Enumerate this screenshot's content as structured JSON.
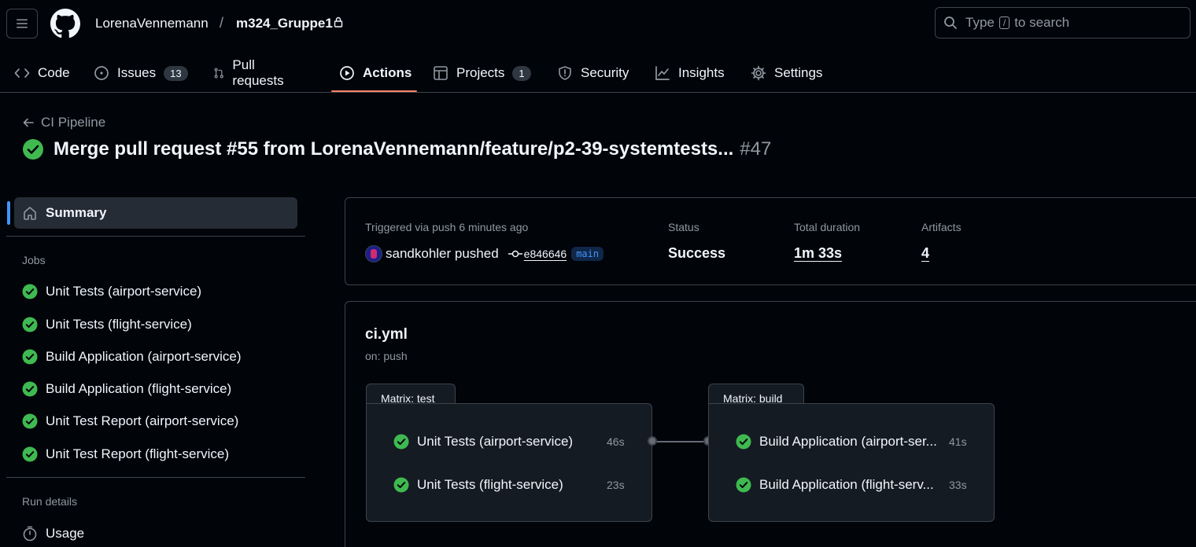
{
  "header": {
    "owner": "LorenaVennemann",
    "separator": "/",
    "repo": "m324_Gruppe1",
    "search": {
      "prefix": "Type",
      "key": "/",
      "suffix": "to search"
    }
  },
  "tabs": [
    {
      "label": "Code",
      "icon": "code-icon"
    },
    {
      "label": "Issues",
      "icon": "issue-icon",
      "count": "13"
    },
    {
      "label": "Pull requests",
      "icon": "pull-request-icon"
    },
    {
      "label": "Actions",
      "icon": "play-icon",
      "active": true
    },
    {
      "label": "Projects",
      "icon": "table-icon",
      "count": "1"
    },
    {
      "label": "Security",
      "icon": "shield-icon"
    },
    {
      "label": "Insights",
      "icon": "graph-icon"
    },
    {
      "label": "Settings",
      "icon": "gear-icon"
    }
  ],
  "run": {
    "workflow_back_label": "CI Pipeline",
    "title": "Merge pull request #55 from LorenaVennemann/feature/p2-39-systemtests...",
    "number": "#47"
  },
  "sidebar": {
    "summary_label": "Summary",
    "jobs_heading": "Jobs",
    "jobs": [
      "Unit Tests (airport-service)",
      "Unit Tests (flight-service)",
      "Build Application (airport-service)",
      "Build Application (flight-service)",
      "Unit Test Report (airport-service)",
      "Unit Test Report (flight-service)"
    ],
    "run_details_heading": "Run details",
    "usage_label": "Usage"
  },
  "summary": {
    "trigger_label": "Triggered via push 6 minutes ago",
    "actor": "sandkohler pushed",
    "commit_sha": "e846646",
    "branch": "main",
    "status_label": "Status",
    "status_value": "Success",
    "duration_label": "Total duration",
    "duration_value": "1m 33s",
    "artifacts_label": "Artifacts",
    "artifacts_value": "4"
  },
  "workflow": {
    "file": "ci.yml",
    "trigger": "on: push",
    "matrices": [
      {
        "label": "Matrix: test",
        "jobs": [
          {
            "name": "Unit Tests (airport-service)",
            "duration": "46s"
          },
          {
            "name": "Unit Tests (flight-service)",
            "duration": "23s"
          }
        ]
      },
      {
        "label": "Matrix: build",
        "jobs": [
          {
            "name": "Build Application (airport-ser...",
            "duration": "41s"
          },
          {
            "name": "Build Application (flight-serv...",
            "duration": "33s"
          }
        ]
      }
    ]
  },
  "colors": {
    "success": "#3fb950",
    "accent_underline": "#f78166",
    "link": "#4493f8",
    "background": "#010409"
  }
}
